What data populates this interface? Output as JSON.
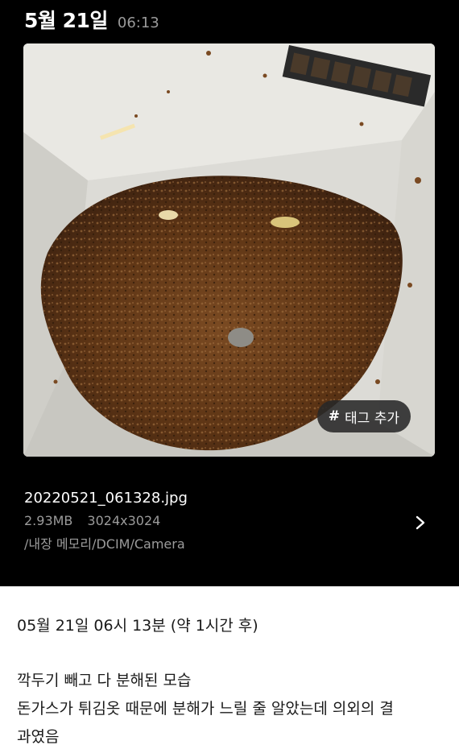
{
  "header": {
    "date": "5월 21일",
    "time": "06:13"
  },
  "photo": {
    "tag_button_label": "태그 추가",
    "tag_hash": "#"
  },
  "file": {
    "name": "20220521_061328.jpg",
    "size": "2.93MB",
    "resolution": "3024x3024",
    "path": "/내장 메모리/DCIM/Camera"
  },
  "note": {
    "datetime_line": "05월 21일 06시 13분 (약 1시간 후)",
    "body_line1": "깍두기 빼고 다 분해된 모습",
    "body_line2": "돈가스가 튀김옷 때문에 분해가 느릴 줄 알았는데 의외의 결",
    "body_line3": "과였음"
  }
}
